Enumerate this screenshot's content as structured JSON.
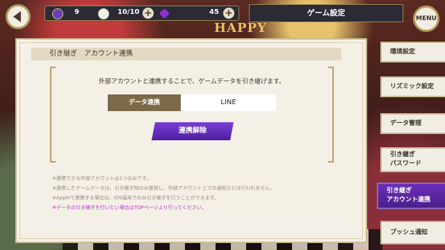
{
  "topbar": {
    "stat1_value": "9",
    "stat2_value": "10/10",
    "stat3_value": "45",
    "screen_title": "ゲーム設定",
    "menu_label": "MENU"
  },
  "background": {
    "banner_text": "HAPPY"
  },
  "section": {
    "title": "引き継ぎ　アカウント連携"
  },
  "main": {
    "description": "外部アカウントと連携することで、ゲームデータを引き継げます。",
    "link_label": "データ連携",
    "link_value": "LINE",
    "unlink_button": "連携解除",
    "notes": [
      "※連携できる外部アカウントは1つのみです。",
      "※連携したゲームデータは、引き継ぎ時のみ使用し、外部アカウント上での通知などは行われません。",
      "※Appleで連携する場合は、iOS端末でのみ引き継ぎを行うことができます。",
      "※データの引き継ぎを行いたい場合はTOPページより行ってください。"
    ]
  },
  "side_menu": {
    "items": [
      {
        "label": "環境設定"
      },
      {
        "label": "リズミック設定"
      },
      {
        "label": "データ管理"
      },
      {
        "line1": "引き継ぎ",
        "line2": "パスワード"
      },
      {
        "line1": "引き継ぎ",
        "line2": "アカウント連携"
      },
      {
        "label": "プッシュ通知"
      }
    ],
    "active_index": 4
  },
  "colors": {
    "accent_purple": "#5b2aa8",
    "note_highlight": "#c52ad2",
    "link_label_bg": "#7a6a4a",
    "gold_border": "#b99b5f"
  },
  "icons": {
    "back": "chevron-left-icon",
    "stat1": "star-coin-icon",
    "stat2": "flower-icon",
    "stat3": "gem-icon",
    "add": "plus-icon"
  }
}
